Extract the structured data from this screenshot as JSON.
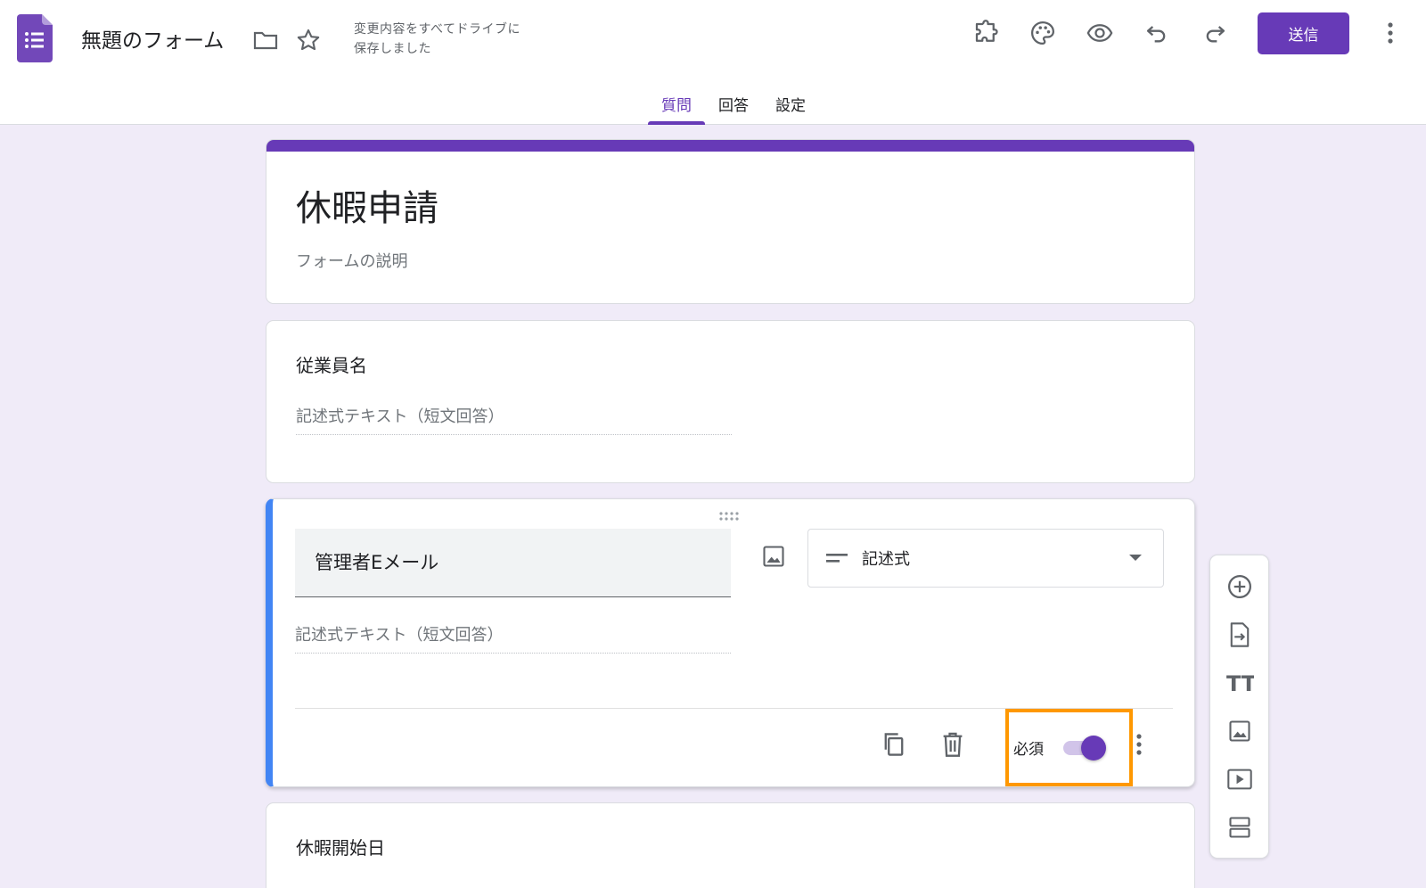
{
  "app": {
    "doc_title": "無題のフォーム",
    "save_status_line1": "変更内容をすべてドライブに",
    "save_status_line2": "保存しました",
    "send_label": "送信",
    "icons": [
      "forms-logo-icon",
      "folder-icon",
      "star-icon",
      "addon-puzzle-icon",
      "palette-icon",
      "preview-eye-icon",
      "undo-icon",
      "redo-icon",
      "more-vert-icon"
    ]
  },
  "tabs": [
    {
      "label": "質問",
      "active": true
    },
    {
      "label": "回答",
      "active": false
    },
    {
      "label": "設定",
      "active": false
    }
  ],
  "form": {
    "title": "休暇申請",
    "description_placeholder": "フォームの説明"
  },
  "questions": [
    {
      "title": "従業員名",
      "answer_placeholder": "記述式テキスト（短文回答）"
    },
    {
      "title": "管理者Eメール",
      "type_label": "記述式",
      "answer_placeholder": "記述式テキスト（短文回答）",
      "required_label": "必須",
      "required": true
    },
    {
      "title": "休暇開始日"
    }
  ],
  "theme": {
    "accent": "#673ab7",
    "active_question_border": "#4285f4",
    "highlight": "#ff9800",
    "background": "#f0ebf8"
  },
  "side_toolbar": {
    "items": [
      "add-question",
      "import-questions",
      "add-title",
      "add-image",
      "add-video",
      "add-section"
    ],
    "title_glyph": "TT"
  }
}
